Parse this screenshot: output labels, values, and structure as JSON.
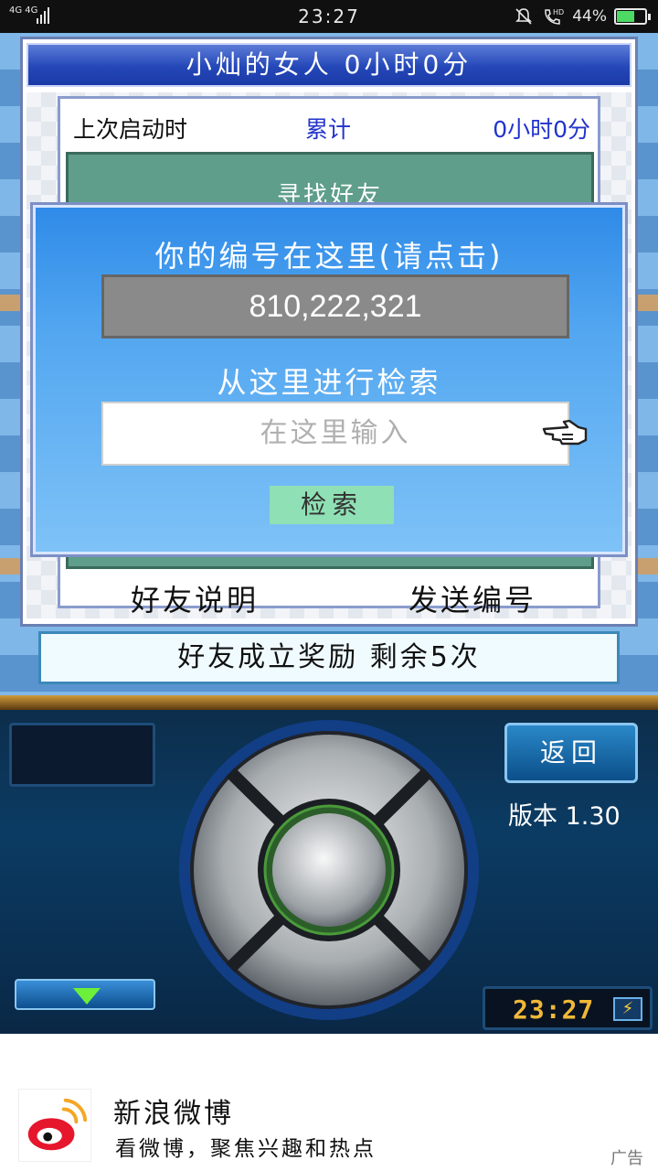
{
  "status_bar": {
    "network": "4G 4G",
    "time": "23:27",
    "hd_label": "HD",
    "battery_text": "44%",
    "battery_level": 0.44
  },
  "window": {
    "title": "小灿的女人 0小时0分",
    "last_start_label": "上次启动时",
    "total_label": "累计",
    "total_value": "0小时0分",
    "find_friends_label": "寻找好友",
    "friend_help_label": "好友说明",
    "send_id_label": "发送编号"
  },
  "id_dialog": {
    "heading": "你的编号在这里(请点击)",
    "id_value": "810,222,321",
    "search_heading": "从这里进行检索",
    "search_placeholder": "在这里输入",
    "search_button": "检索"
  },
  "reward_bar": {
    "text": "好友成立奖励 剩余5次"
  },
  "device": {
    "back_button": "返回",
    "version": "版本 1.30",
    "clock": "23:27"
  },
  "ad": {
    "app_name": "新浪微博",
    "description": "看微博，聚焦兴趣和热点",
    "tag": "广告"
  }
}
